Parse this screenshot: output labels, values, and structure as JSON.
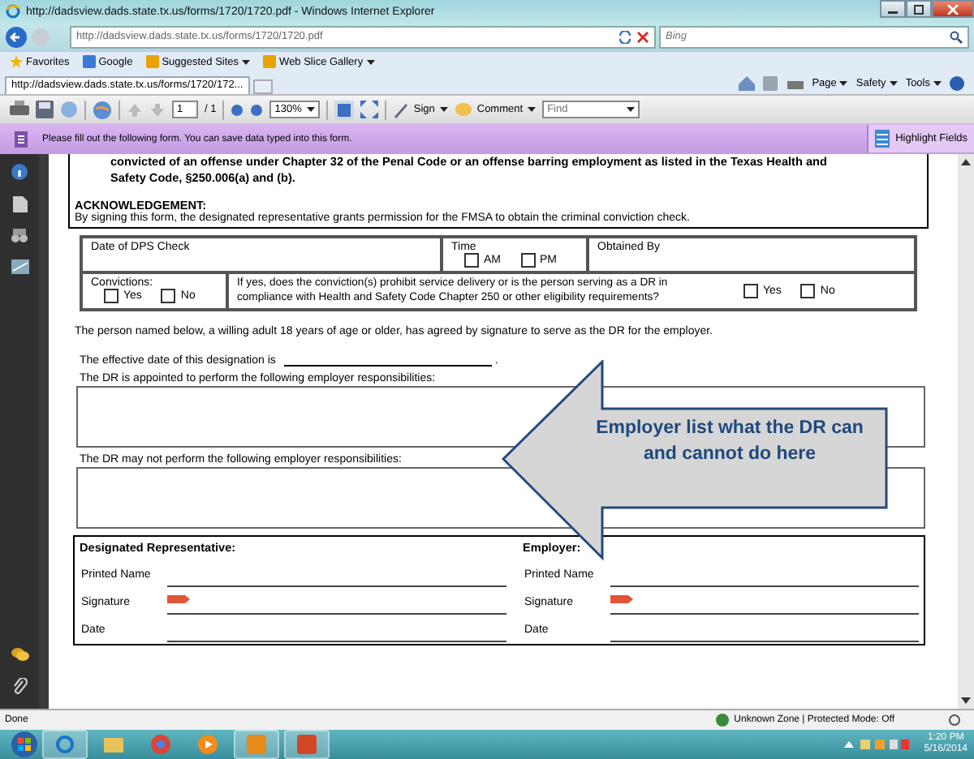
{
  "window": {
    "title": "http://dadsview.dads.state.tx.us/forms/1720/1720.pdf - Windows Internet Explorer"
  },
  "address_bar": {
    "url": "http://dadsview.dads.state.tx.us/forms/1720/1720.pdf"
  },
  "search": {
    "placeholder": "Bing"
  },
  "favorites_bar": [
    {
      "label": "Favorites",
      "kind": "favorites"
    },
    {
      "label": "Google",
      "kind": "site"
    },
    {
      "label": "Suggested Sites",
      "kind": "menu"
    },
    {
      "label": "Web Slice Gallery",
      "kind": "menu"
    }
  ],
  "tabs": [
    {
      "label": "http://dadsview.dads.state.tx.us/forms/1720/172...",
      "selected": true
    }
  ],
  "command_bar": [
    "Page",
    "Safety",
    "Tools"
  ],
  "pdf_toolbar": {
    "page": "1",
    "page_count": "/ 1",
    "zoom": "130%",
    "sign": "Sign",
    "comment": "Comment",
    "find_placeholder": "Find"
  },
  "form_bar": {
    "message": "Please fill out the following form. You can save data typed into this form.",
    "button": "Highlight Fields"
  },
  "document": {
    "intro_lines": [
      "convicted of an offense under Chapter 32 of the Penal Code or an offense barring employment as listed in the Texas Health and",
      "Safety Code, §250.006(a) and (b)."
    ],
    "acknowledgement": {
      "heading": "ACKNOWLEDGEMENT:",
      "text": "By signing this form, the designated representative grants permission for the FMSA to obtain the criminal conviction check."
    },
    "dps_table": {
      "date_label": "Date of DPS Check",
      "time_label": "Time",
      "time_options": [
        {
          "label": "AM",
          "checked": false
        },
        {
          "label": "PM",
          "checked": false
        }
      ],
      "obtained_label": "Obtained By",
      "convictions_label": "Convictions:",
      "conviction_options": [
        {
          "label": "Yes",
          "checked": false
        },
        {
          "label": "No",
          "checked": false
        }
      ],
      "question": "If yes, does the conviction(s) prohibit service delivery or is the person serving as a DR in compliance with Health and Safety Code Chapter 250 or other eligibility requirements?",
      "question_options": [
        {
          "label": "Yes",
          "checked": false
        },
        {
          "label": "No",
          "checked": false
        }
      ]
    },
    "agreement": "The person named below, a willing adult 18 years of age or older, has agreed by signature to serve as the DR for the employer.",
    "effective_date": {
      "label": "The effective date of this designation is",
      "end": "."
    },
    "responsibility_boxes": [
      {
        "label": "The DR is appointed to perform the following employer responsibilities:"
      },
      {
        "label": "The DR may not perform the following employer responsibilities:"
      }
    ],
    "signature_columns": [
      {
        "heading": "Designated Representative:",
        "fields": [
          {
            "label": "Printed Name",
            "kind": "text"
          },
          {
            "label": "Signature",
            "kind": "signature"
          },
          {
            "label": "Date",
            "kind": "text"
          }
        ]
      },
      {
        "heading": "Employer:",
        "fields": [
          {
            "label": "Printed Name",
            "kind": "text"
          },
          {
            "label": "Signature",
            "kind": "signature"
          },
          {
            "label": "Date",
            "kind": "text"
          }
        ]
      }
    ]
  },
  "callout": {
    "text": "Employer list what the DR can and cannot do here"
  },
  "status_bar": {
    "status": "Done",
    "zone": "Unknown Zone | Protected Mode: Off"
  },
  "taskbar": {
    "time": "1:20 PM",
    "date": "5/16/2014"
  }
}
